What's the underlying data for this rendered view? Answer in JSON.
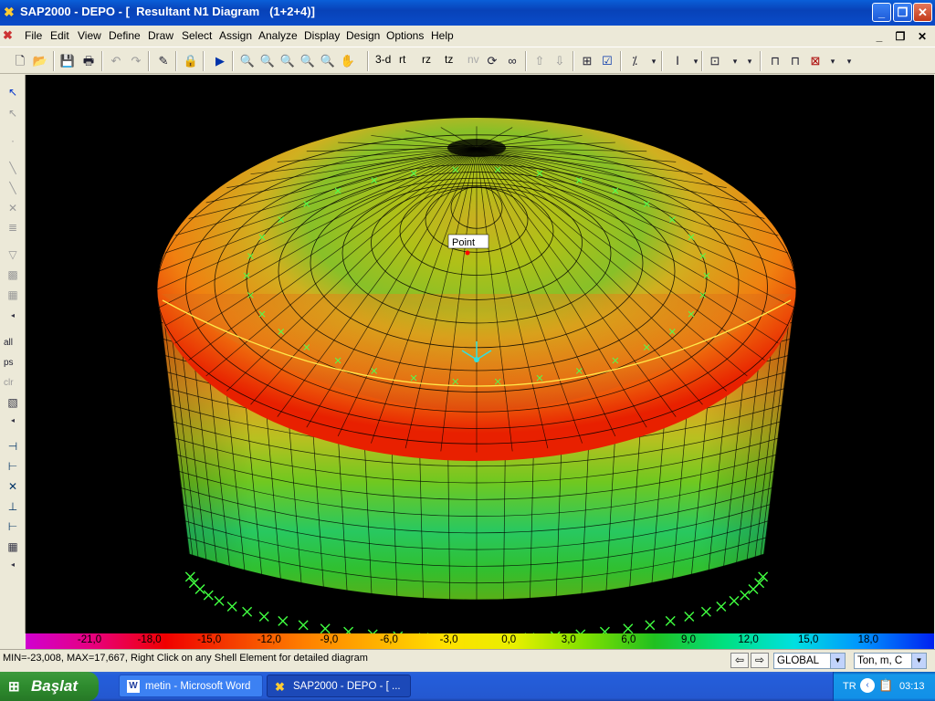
{
  "window": {
    "title": "SAP2000 - DEPO - [  Resultant N1 Diagram   (1+2+4)]",
    "min": "_",
    "max": "❐",
    "close": "✕"
  },
  "menu": [
    "File",
    "Edit",
    "View",
    "Define",
    "Draw",
    "Select",
    "Assign",
    "Analyze",
    "Display",
    "Design",
    "Options",
    "Help"
  ],
  "toolbar": {
    "view_3d": "3-d",
    "view_rt": "rt",
    "view_rz": "rz",
    "view_tz": "tz",
    "view_nv": "nv"
  },
  "side_toolbar": {
    "select_all": "all",
    "select_ps": "ps",
    "select_clr": "clr"
  },
  "viewport": {
    "point_label": "Point"
  },
  "legend": {
    "labels": [
      "-21,0",
      "-18,0",
      "-15,0",
      "-12,0",
      "-9,0",
      "-6,0",
      "-3,0",
      "0,0",
      "3,0",
      "6,0",
      "9,0",
      "12,0",
      "15,0",
      "18,0"
    ],
    "colors": [
      "#d000d0",
      "#e8007a",
      "#f00000",
      "#f54000",
      "#ff8000",
      "#ffb000",
      "#ffe000",
      "#e8f000",
      "#80e000",
      "#20c020",
      "#00e080",
      "#00e0e0",
      "#0090ff",
      "#0020f0"
    ]
  },
  "status": {
    "text": "MIN=-23,008, MAX=17,667, Right Click on any Shell Element for detailed diagram",
    "coord_system": "GLOBAL",
    "units": "Ton, m, C"
  },
  "taskbar": {
    "start": "Başlat",
    "tasks": [
      "metin - Microsoft Word",
      "SAP2000 - DEPO - [  ..."
    ],
    "lang": "TR",
    "clock": "03:13"
  }
}
